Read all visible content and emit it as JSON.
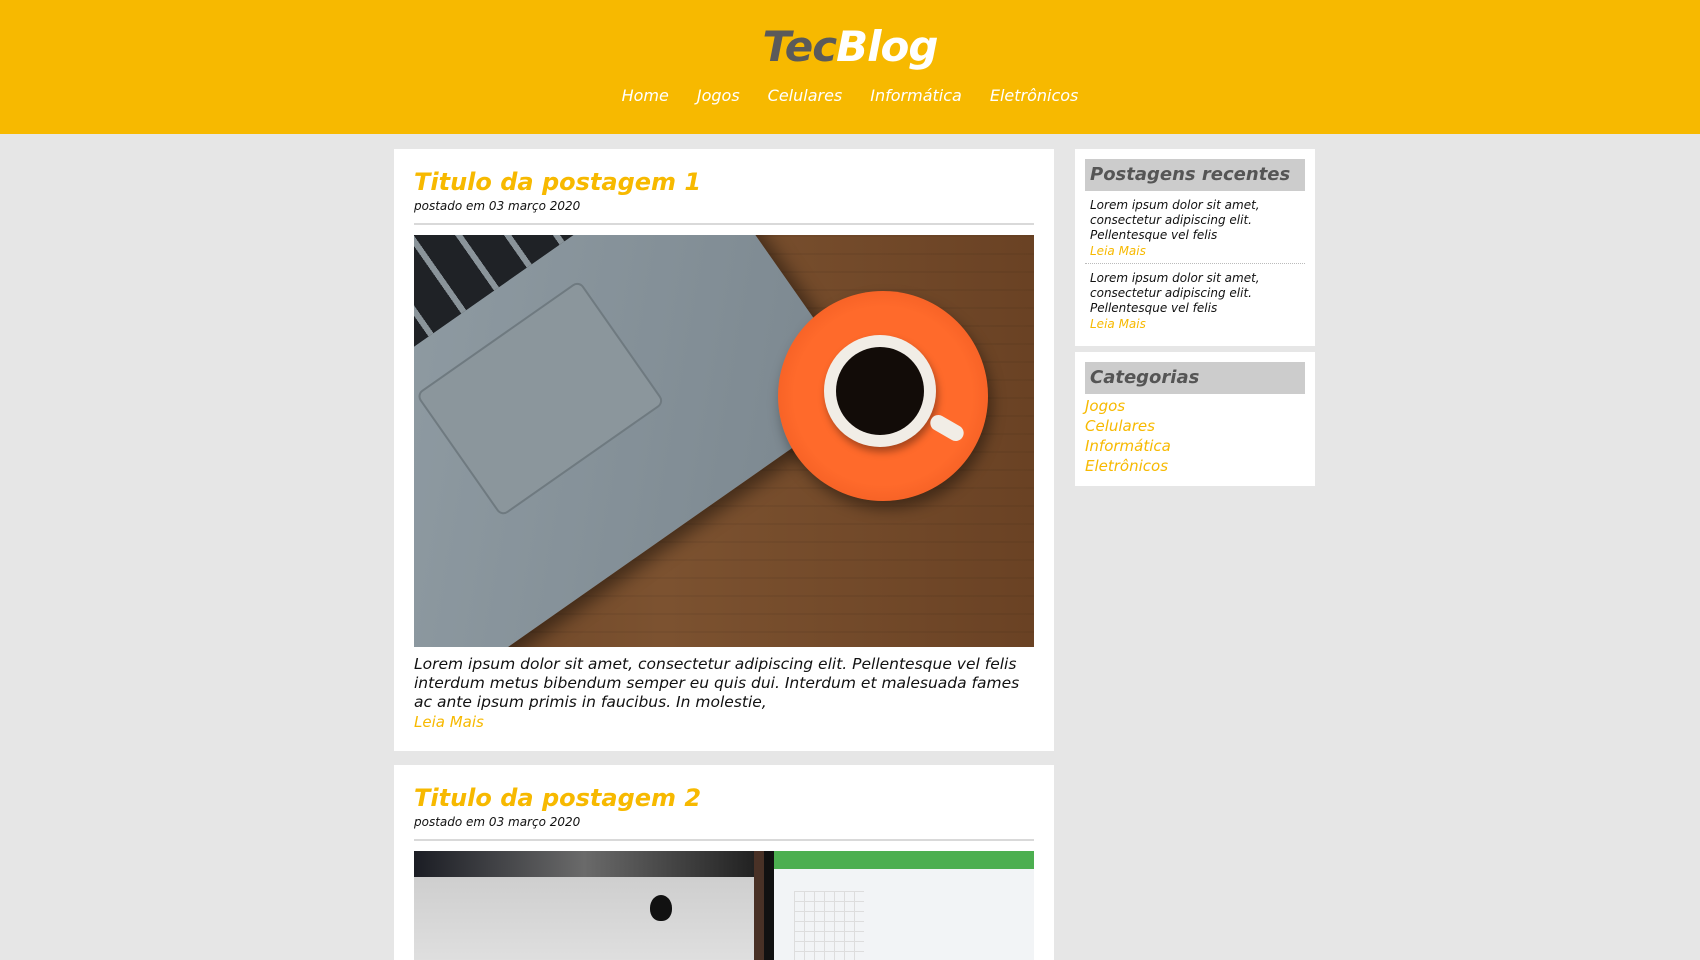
{
  "header": {
    "logo_part1": "Tec",
    "logo_part2": "Blog",
    "nav": [
      "Home",
      "Jogos",
      "Celulares",
      "Informática",
      "Eletrônicos"
    ]
  },
  "posts": [
    {
      "title": "Titulo da postagem 1",
      "date": "postado em 03 março 2020",
      "excerpt": "Lorem ipsum dolor sit amet, consectetur adipiscing elit. Pellentesque vel felis interdum metus bibendum semper eu quis dui. Interdum et malesuada fames ac ante ipsum primis in faucibus. In molestie,",
      "read_more": "Leia Mais"
    },
    {
      "title": "Titulo da postagem 2",
      "date": "postado em 03 março 2020"
    }
  ],
  "sidebar": {
    "recent_title": "Postagens recentes",
    "recent": [
      {
        "text": "Lorem ipsum dolor sit amet, consectetur adipiscing elit. Pellentesque vel felis",
        "link": "Leia Mais"
      },
      {
        "text": "Lorem ipsum dolor sit amet, consectetur adipiscing elit. Pellentesque vel felis",
        "link": "Leia Mais"
      }
    ],
    "categories_title": "Categorias",
    "categories": [
      "Jogos",
      "Celulares",
      "Informática",
      "Eletrônicos"
    ]
  },
  "colors": {
    "accent": "#f7b900",
    "background": "#e6e6e6",
    "widget_title_bg": "#cccccc"
  }
}
